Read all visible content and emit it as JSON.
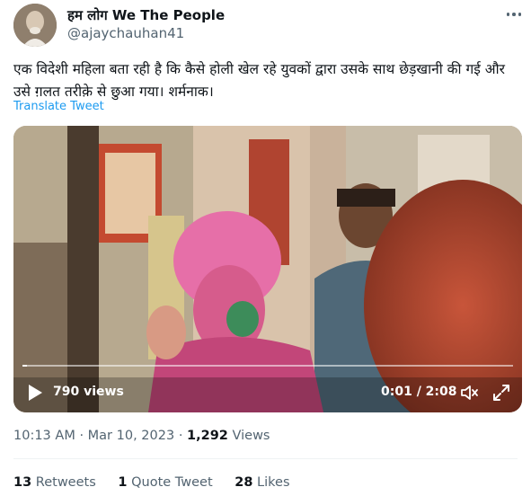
{
  "author": {
    "name": "हम लोग We The People",
    "handle": "@ajaychauhan41"
  },
  "tweet": {
    "text": "एक विदेशी महिला बता रही है कि कैसे होली खेल रहे युवकों द्वारा उसके साथ छेड़खानी की गई और उसे ग़लत तरीक़े से छुआ गया। शर्मनाक।",
    "translate_label": "Translate Tweet"
  },
  "video": {
    "views": "790 views",
    "timestamp": "0:01 / 2:08",
    "progress": 0.01
  },
  "meta": {
    "time": "10:13 AM",
    "separator": "·",
    "date": "Mar 10, 2023",
    "views_count": "1,292",
    "views_label": "Views"
  },
  "stats": {
    "retweets_count": "13",
    "retweets_label": "Retweets",
    "quotes_count": "1",
    "quotes_label": "Quote Tweet",
    "likes_count": "28",
    "likes_label": "Likes"
  },
  "colors": {
    "link": "#1d9bf0",
    "secondary_text": "#536471",
    "primary_text": "#0f1419"
  }
}
